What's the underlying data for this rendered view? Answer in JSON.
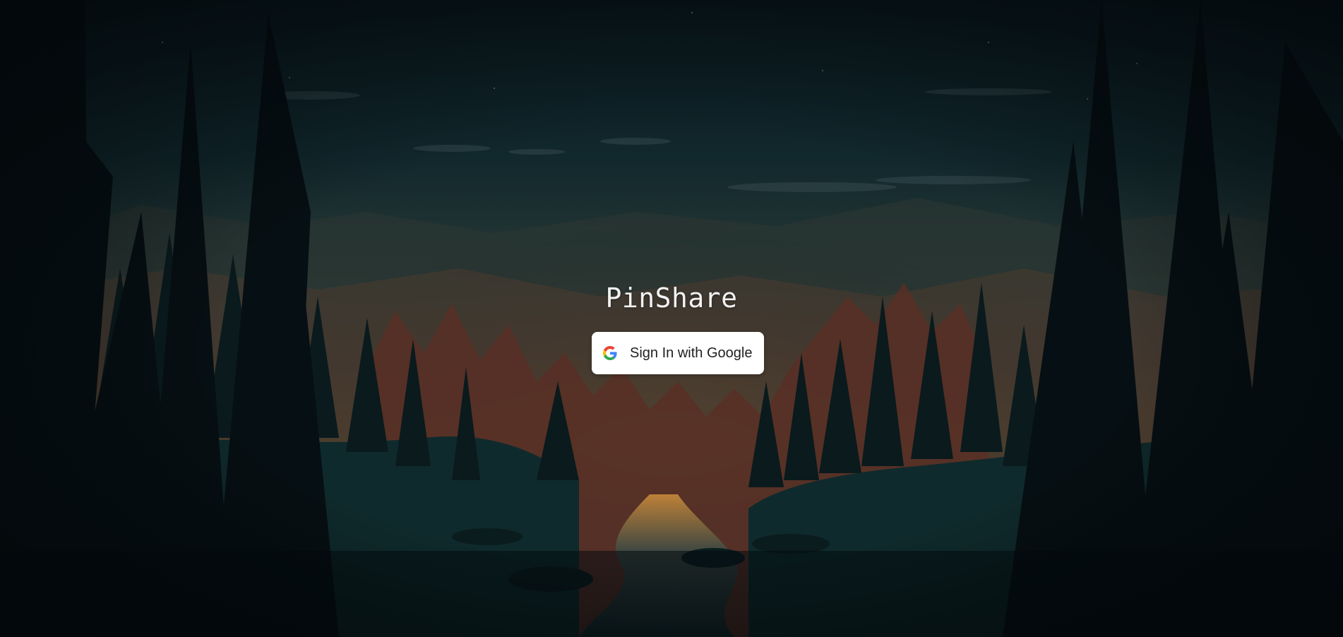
{
  "app": {
    "title": "PinShare"
  },
  "auth": {
    "google_button_label": "Sign In with Google",
    "google_icon": "google-g-icon"
  },
  "background": {
    "scene": "forest-river-sunset-illustration",
    "sky_color": "#0e2329",
    "glow_color": "#c77a2c"
  }
}
